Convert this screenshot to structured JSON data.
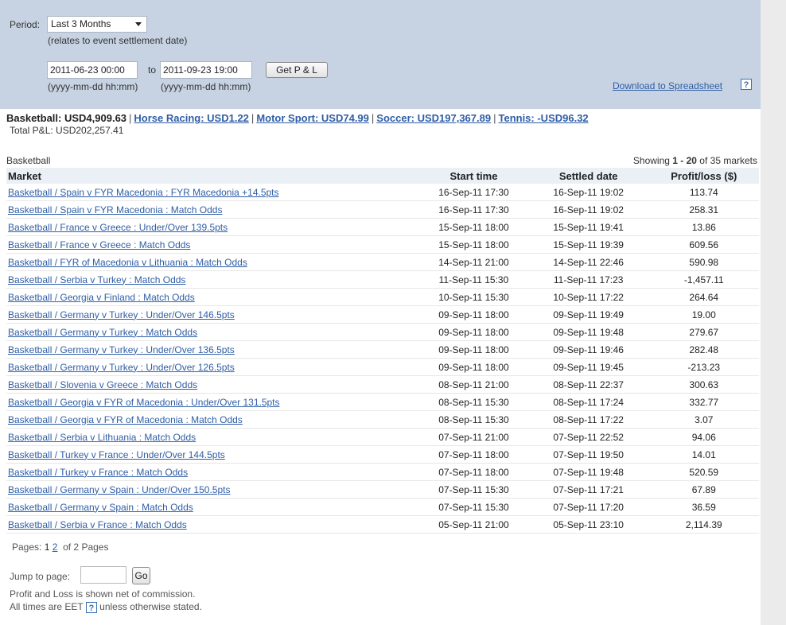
{
  "filter": {
    "period_label": "Period:",
    "period_value": "Last 3 Months",
    "period_note": "(relates to event settlement date)",
    "from_value": "2011-06-23 00:00",
    "to_label": "to",
    "to_value": "2011-09-23 19:00",
    "get_pl_label": "Get P & L",
    "from_format": "(yyyy-mm-dd hh:mm)",
    "to_format": "(yyyy-mm-dd hh:mm)",
    "download_label": "Download to Spreadsheet",
    "help_glyph": "?"
  },
  "summary": {
    "basketball": "Basketball: USD4,909.63",
    "horse_racing": "Horse Racing: USD1.22",
    "motor_sport": "Motor Sport: USD74.99",
    "soccer": "Soccer: USD197,367.89",
    "tennis": "Tennis: -USD96.32",
    "separator": "|",
    "total_pl": "Total P&L:  USD202,257.41"
  },
  "table": {
    "section_title": "Basketball",
    "showing_prefix": "Showing ",
    "showing_range": "1 - 20",
    "showing_suffix": " of 35 markets",
    "headers": {
      "market": "Market",
      "start": "Start time",
      "settled": "Settled date",
      "pl": "Profit/loss ($)"
    },
    "rows": [
      {
        "market": "Basketball / Spain v FYR Macedonia : FYR Macedonia +14.5pts",
        "start": "16-Sep-11 17:30",
        "settled": "16-Sep-11 19:02",
        "pl": "113.74"
      },
      {
        "market": "Basketball / Spain v FYR Macedonia : Match Odds",
        "start": "16-Sep-11 17:30",
        "settled": "16-Sep-11 19:02",
        "pl": "258.31"
      },
      {
        "market": "Basketball / France v Greece : Under/Over 139.5pts",
        "start": "15-Sep-11 18:00",
        "settled": "15-Sep-11 19:41",
        "pl": "13.86"
      },
      {
        "market": "Basketball / France v Greece : Match Odds",
        "start": "15-Sep-11 18:00",
        "settled": "15-Sep-11 19:39",
        "pl": "609.56"
      },
      {
        "market": "Basketball / FYR of Macedonia v Lithuania : Match Odds",
        "start": "14-Sep-11 21:00",
        "settled": "14-Sep-11 22:46",
        "pl": "590.98"
      },
      {
        "market": "Basketball / Serbia v Turkey : Match Odds",
        "start": "11-Sep-11 15:30",
        "settled": "11-Sep-11 17:23",
        "pl": "-1,457.11"
      },
      {
        "market": "Basketball / Georgia v Finland : Match Odds",
        "start": "10-Sep-11 15:30",
        "settled": "10-Sep-11 17:22",
        "pl": "264.64"
      },
      {
        "market": "Basketball / Germany v Turkey : Under/Over 146.5pts",
        "start": "09-Sep-11 18:00",
        "settled": "09-Sep-11 19:49",
        "pl": "19.00"
      },
      {
        "market": "Basketball / Germany v Turkey : Match Odds",
        "start": "09-Sep-11 18:00",
        "settled": "09-Sep-11 19:48",
        "pl": "279.67"
      },
      {
        "market": "Basketball / Germany v Turkey : Under/Over 136.5pts",
        "start": "09-Sep-11 18:00",
        "settled": "09-Sep-11 19:46",
        "pl": "282.48"
      },
      {
        "market": "Basketball / Germany v Turkey : Under/Over 126.5pts",
        "start": "09-Sep-11 18:00",
        "settled": "09-Sep-11 19:45",
        "pl": "-213.23"
      },
      {
        "market": "Basketball / Slovenia v Greece : Match Odds",
        "start": "08-Sep-11 21:00",
        "settled": "08-Sep-11 22:37",
        "pl": "300.63"
      },
      {
        "market": "Basketball / Georgia v FYR of Macedonia : Under/Over 131.5pts",
        "start": "08-Sep-11 15:30",
        "settled": "08-Sep-11 17:24",
        "pl": "332.77"
      },
      {
        "market": "Basketball / Georgia v FYR of Macedonia : Match Odds",
        "start": "08-Sep-11 15:30",
        "settled": "08-Sep-11 17:22",
        "pl": "3.07"
      },
      {
        "market": "Basketball / Serbia v Lithuania : Match Odds",
        "start": "07-Sep-11 21:00",
        "settled": "07-Sep-11 22:52",
        "pl": "94.06"
      },
      {
        "market": "Basketball / Turkey v France : Under/Over 144.5pts",
        "start": "07-Sep-11 18:00",
        "settled": "07-Sep-11 19:50",
        "pl": "14.01"
      },
      {
        "market": "Basketball / Turkey v France : Match Odds",
        "start": "07-Sep-11 18:00",
        "settled": "07-Sep-11 19:48",
        "pl": "520.59"
      },
      {
        "market": "Basketball / Germany v Spain : Under/Over 150.5pts",
        "start": "07-Sep-11 15:30",
        "settled": "07-Sep-11 17:21",
        "pl": "67.89"
      },
      {
        "market": "Basketball / Germany v Spain : Match Odds",
        "start": "07-Sep-11 15:30",
        "settled": "07-Sep-11 17:20",
        "pl": "36.59"
      },
      {
        "market": "Basketball / Serbia v France : Match Odds",
        "start": "05-Sep-11 21:00",
        "settled": "05-Sep-11 23:10",
        "pl": "2,114.39"
      }
    ]
  },
  "pagination": {
    "label": "Pages:",
    "current": "1",
    "next": "2",
    "of_text": "of 2 Pages",
    "jump_label": "Jump to page:",
    "go_label": "Go"
  },
  "notes": {
    "commission": "Profit and Loss is shown net of commission.",
    "times_prefix": "All times are EET",
    "times_suffix": "unless otherwise stated."
  }
}
